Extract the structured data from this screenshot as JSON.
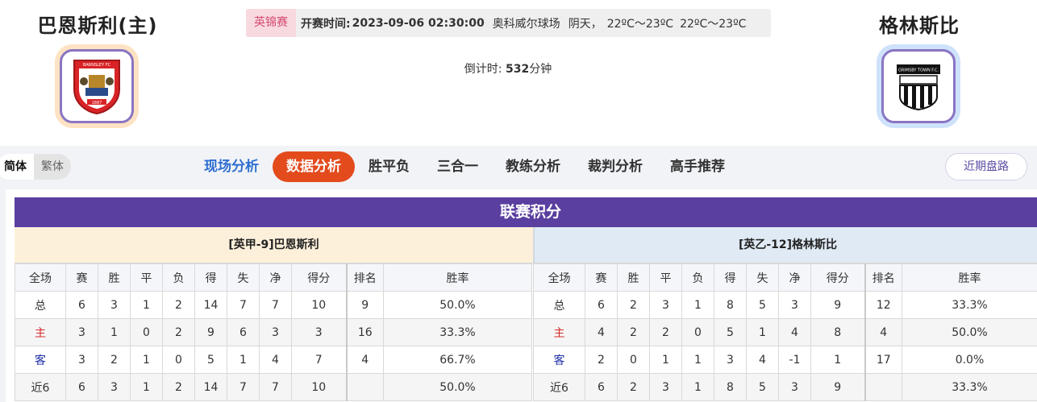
{
  "match": {
    "home_team": "巴恩斯利(主)",
    "away_team": "格林斯比",
    "league": "英锦赛",
    "start_label": "开赛时间:",
    "start_time": "2023-09-06 02:30:00",
    "venue": "奥科威尔球场",
    "weather": "阴天，",
    "temp1": "22ºC～23ºC",
    "temp2": "22ºC～23ºC",
    "countdown_label": "倒计时:",
    "countdown_value": "532",
    "countdown_unit": "分钟",
    "home_logo_text": "BARNSLEY FC",
    "home_logo_year": "1887",
    "away_logo_text": "GRIMSBY TOWN F.C."
  },
  "lang": {
    "simplified": "简体",
    "traditional": "繁体"
  },
  "tabs": [
    {
      "label": "现场分析"
    },
    {
      "label": "数据分析"
    },
    {
      "label": "胜平负"
    },
    {
      "label": "三合一"
    },
    {
      "label": "教练分析"
    },
    {
      "label": "裁判分析"
    },
    {
      "label": "高手推荐"
    }
  ],
  "recent_odds_button": "近期盘路",
  "standings": {
    "title": "联赛积分",
    "columns": [
      "全场",
      "赛",
      "胜",
      "平",
      "负",
      "得",
      "失",
      "净",
      "得分",
      "排名",
      "胜率"
    ],
    "home": {
      "header": "[英甲-9]巴恩斯利",
      "rows": [
        [
          "总",
          "6",
          "3",
          "1",
          "2",
          "14",
          "7",
          "7",
          "10",
          "9",
          "50.0%"
        ],
        [
          "主",
          "3",
          "1",
          "0",
          "2",
          "9",
          "6",
          "3",
          "3",
          "16",
          "33.3%"
        ],
        [
          "客",
          "3",
          "2",
          "1",
          "0",
          "5",
          "1",
          "4",
          "7",
          "4",
          "66.7%"
        ],
        [
          "近6",
          "6",
          "3",
          "1",
          "2",
          "14",
          "7",
          "7",
          "10",
          "",
          "50.0%"
        ]
      ]
    },
    "away": {
      "header": "[英乙-12]格林斯比",
      "rows": [
        [
          "总",
          "6",
          "2",
          "3",
          "1",
          "8",
          "5",
          "3",
          "9",
          "12",
          "33.3%"
        ],
        [
          "主",
          "4",
          "2",
          "2",
          "0",
          "5",
          "1",
          "4",
          "8",
          "4",
          "50.0%"
        ],
        [
          "客",
          "2",
          "0",
          "1",
          "1",
          "3",
          "4",
          "-1",
          "1",
          "17",
          "0.0%"
        ],
        [
          "近6",
          "6",
          "2",
          "3",
          "1",
          "8",
          "5",
          "3",
          "9",
          "",
          "33.3%"
        ]
      ]
    }
  },
  "colors": {
    "title_bar": "#5a3fa0",
    "active_tab": "#e34b1d",
    "home_label": "#d62a2a",
    "away_label": "#1f2fa8"
  }
}
